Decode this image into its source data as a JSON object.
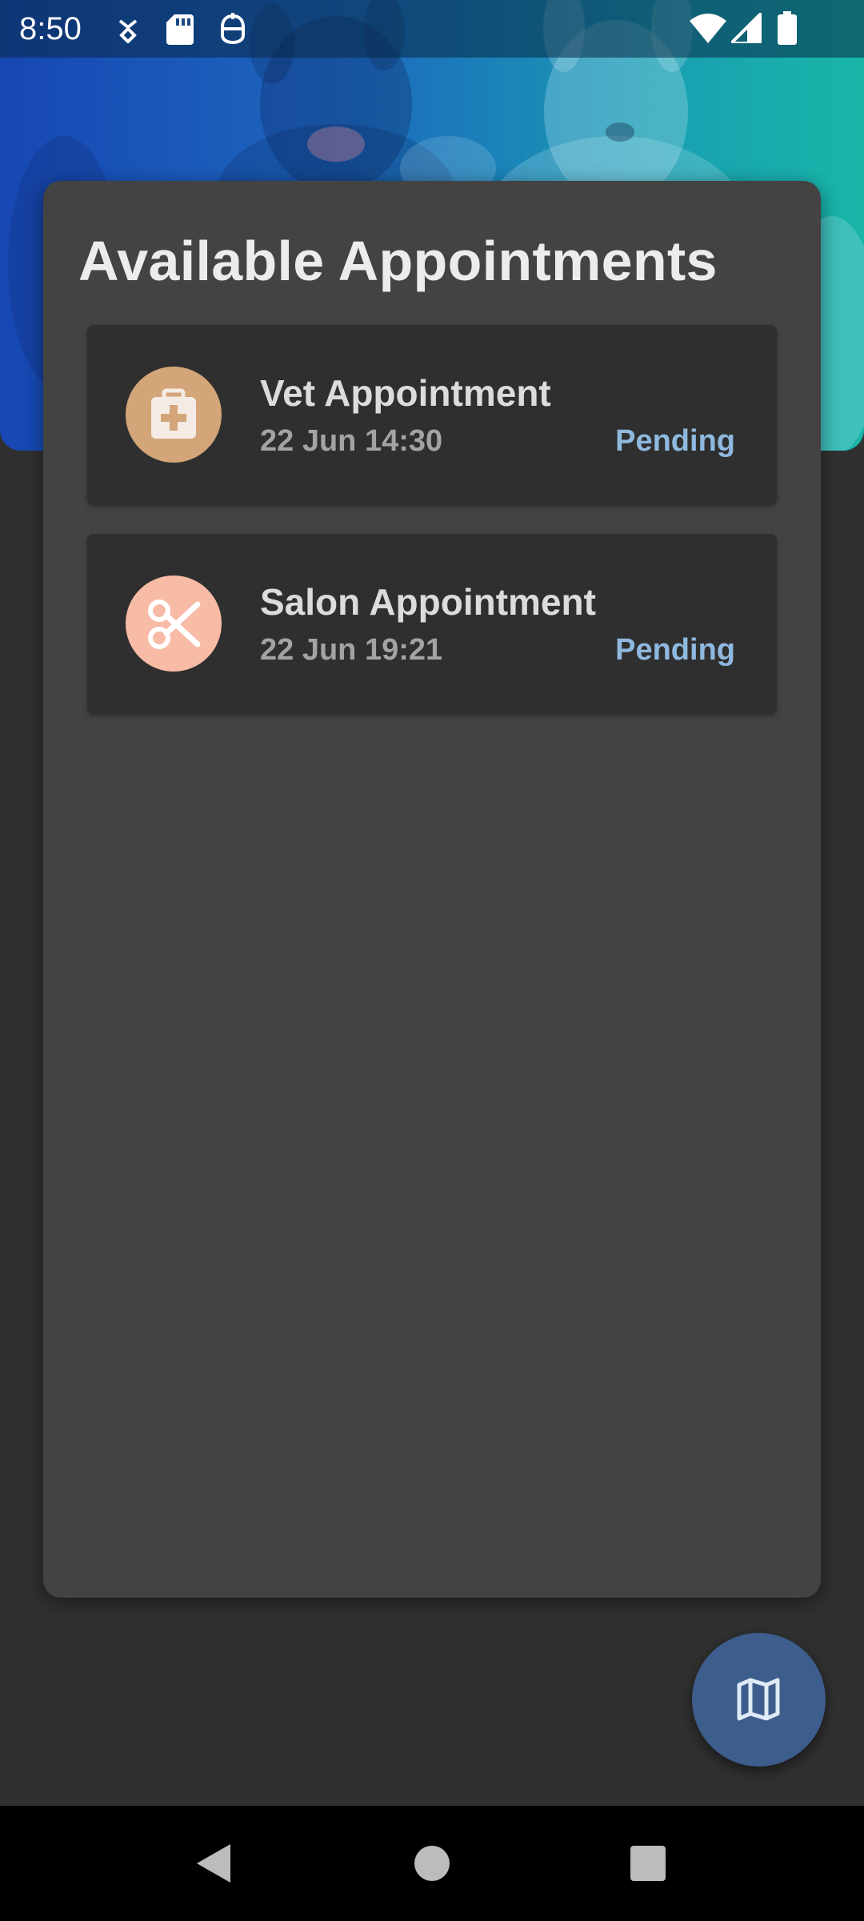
{
  "status_bar": {
    "time": "8:50",
    "icons": [
      "download-notification-icon",
      "sd-card-icon",
      "accessibility-icon",
      "wifi-icon",
      "cell-signal-icon",
      "battery-icon"
    ]
  },
  "header": {
    "background_colors": [
      "#1747b4",
      "#19b6a8"
    ]
  },
  "panel": {
    "title": "Available Appointments"
  },
  "appointments": [
    {
      "title": "Vet Appointment",
      "datetime": "22 Jun 14:30",
      "status": "Pending",
      "icon": "medical-kit-icon",
      "icon_color": "#d3a578"
    },
    {
      "title": "Salon Appointment",
      "datetime": "22 Jun 19:21",
      "status": "Pending",
      "icon": "scissors-icon",
      "icon_color": "#f8bba5"
    }
  ],
  "fab": {
    "icon": "map-icon"
  },
  "nav_bar": {
    "buttons": [
      "back-icon",
      "home-icon",
      "recents-icon"
    ]
  },
  "colors": {
    "status_pending": "#8fb9df",
    "card_background": "#434343",
    "item_background": "#2f2f2f",
    "fab_background": "#3d5d8c"
  }
}
